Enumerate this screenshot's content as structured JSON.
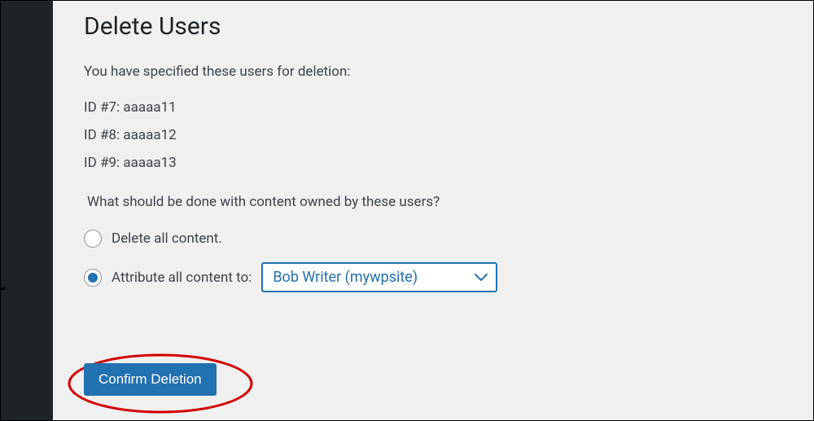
{
  "header": {
    "title": "Delete Users"
  },
  "intro_text": "You have specified these users for deletion:",
  "users": [
    "ID #7: aaaaa11",
    "ID #8: aaaaa12",
    "ID #9: aaaaa13"
  ],
  "content_question": "What should be done with content owned by these users?",
  "options": {
    "delete_all_label": "Delete all content.",
    "attribute_label": "Attribute all content to:",
    "selected": "attribute"
  },
  "reassign_select": {
    "value": "Bob Writer (mywpsite)"
  },
  "submit": {
    "label": "Confirm Deletion"
  },
  "colors": {
    "accent": "#2271b1",
    "annotation": "#d40000"
  }
}
